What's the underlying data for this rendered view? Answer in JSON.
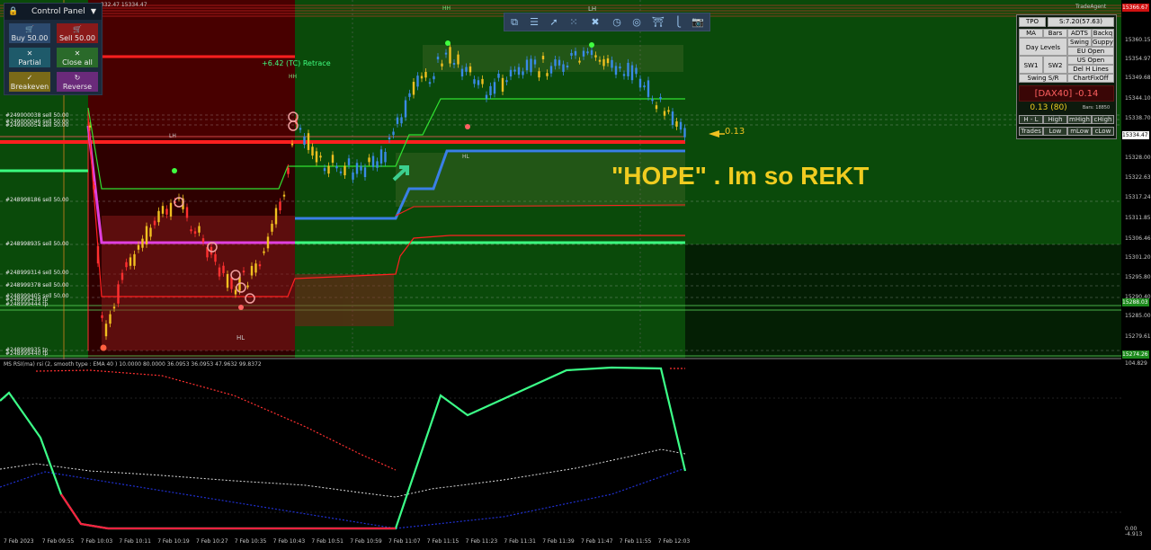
{
  "colors": {
    "bull_bg": "#0a4a0a",
    "bear_bg": "#3a0000",
    "accent_red": "#ff1f1f",
    "accent_blue": "#3a7fe6",
    "rsi_line": "#3cff88",
    "hope_text": "#f0cc20"
  },
  "chart_header": "332.47 15334.47",
  "chart_watermark": "TradeAgent",
  "top_marker": "HH",
  "top_marker_lh": "LH",
  "control_panel": {
    "title": "Control Panel",
    "buy": "Buy 50.00",
    "sell": "Sell 50.00",
    "partial": "Partial",
    "close_all": "Close all",
    "breakeven": "Breakeven",
    "reverse": "Reverse",
    "icons": {
      "lock": "lock-icon",
      "chevron": "chevron-down-icon"
    }
  },
  "retrace_label": "+6.42 (TC) Retrace",
  "hh_label": "HH",
  "lh_label": "LH",
  "hl_label_1": "HL",
  "hl_label_2": "HL",
  "price_pointer": "0.13",
  "annotation": "\"HOPE\" . Im so REKT",
  "orders": [
    "#249000038 sell 50.00",
    "#249000046 sell 50.00",
    "#249000054 sell 50.00",
    "#248998186 sell 50.00",
    "#248998935 sell 50.00",
    "#248999314 sell 50.00",
    "#248999378 sell 50.00",
    "#248999405 sell 50.00",
    "#248999439 tp",
    "#248999444 tp",
    "#248998935 tp",
    "#248999440 tp"
  ],
  "toolbar_icons": [
    "windows-icon",
    "menu-icon",
    "line-icon",
    "fib-icon",
    "crosshair-icon",
    "clock-icon",
    "target-icon",
    "bucket-icon",
    "split-icon",
    "screenshot-icon"
  ],
  "info_panel": {
    "tpo": "TPO",
    "tpo_val": "S:7.20(57.63)",
    "ma": "MA",
    "bars": "Bars",
    "adts": "ADTS",
    "backq": "Backq",
    "day_levels": "Day Levels",
    "swing": "Swing",
    "guppy": "Guppy",
    "eu_open": "EU Open",
    "us_open": "US Open",
    "sw1": "SW1",
    "sw2": "SW2",
    "del_h_lines": "Del H Lines",
    "swing_sr": "Swing S/R",
    "chart_fix": "ChartFixOff",
    "symbol": "[DAX40] -0.14",
    "pl": "0.13 (80)",
    "bars_count": "Bars: 18850",
    "h_l": "H - L",
    "high": "High",
    "mhigh": "mHigh",
    "chigh": "cHigh",
    "trades": "Trades",
    "low": "Low",
    "mlow": "mLow",
    "clow": "cLow"
  },
  "price_axis": [
    "15360.15",
    "15354.97",
    "15349.68",
    "15344.10",
    "15338.70",
    "15334.47",
    "15328.00",
    "15322.63",
    "15317.24",
    "15311.85",
    "15306.46",
    "15301.20",
    "15295.80",
    "15290.40",
    "15285.00",
    "15279.61",
    "15274.26"
  ],
  "price_boxes": {
    "top": "15366.67",
    "current": "15334.47",
    "lower": "15288.03",
    "bottom": "15274.26"
  },
  "rsi": {
    "label": "MS RSI(ma) rsi (2, smooth type : EMA  40 ) 10.0000 80.0000 36.0953 36.0953 47.9632 99.8372",
    "top_value": "104.829",
    "bottom_value": "-4.913",
    "zero": "0.00"
  },
  "time_axis": [
    "7 Feb 2023",
    "7 Feb 09:55",
    "7 Feb 10:03",
    "7 Feb 10:11",
    "7 Feb 10:19",
    "7 Feb 10:27",
    "7 Feb 10:35",
    "7 Feb 10:43",
    "7 Feb 10:51",
    "7 Feb 10:59",
    "7 Feb 11:07",
    "7 Feb 11:15",
    "7 Feb 11:23",
    "7 Feb 11:31",
    "7 Feb 11:39",
    "7 Feb 11:47",
    "7 Feb 11:55",
    "7 Feb 12:03"
  ]
}
